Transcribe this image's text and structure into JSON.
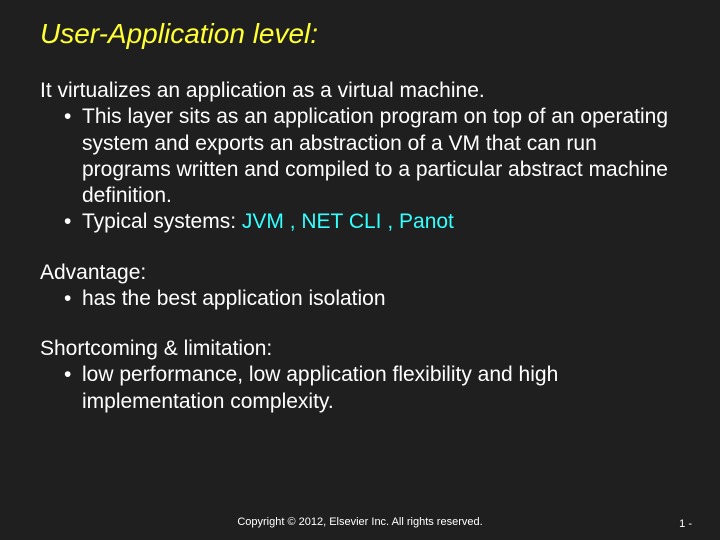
{
  "title": "User-Application level:",
  "sec1": {
    "lead": "It virtualizes an application as a virtual machine.",
    "b1": "This layer sits as an application program on top of an operating system and exports an abstraction of a VM that can run programs written and compiled to a particular abstract machine definition.",
    "b2_prefix": "Typical systems: ",
    "b2_cyan": "JVM ,  NET CLI ,  Panot"
  },
  "sec2": {
    "head": "Advantage:",
    "b1": "has the best application isolation"
  },
  "sec3": {
    "head": "Shortcoming & limitation:",
    "b1": "low performance, low application flexibility and high implementation complexity."
  },
  "footer": "Copyright © 2012, Elsevier Inc. All rights reserved.",
  "pagenum": "1 -"
}
